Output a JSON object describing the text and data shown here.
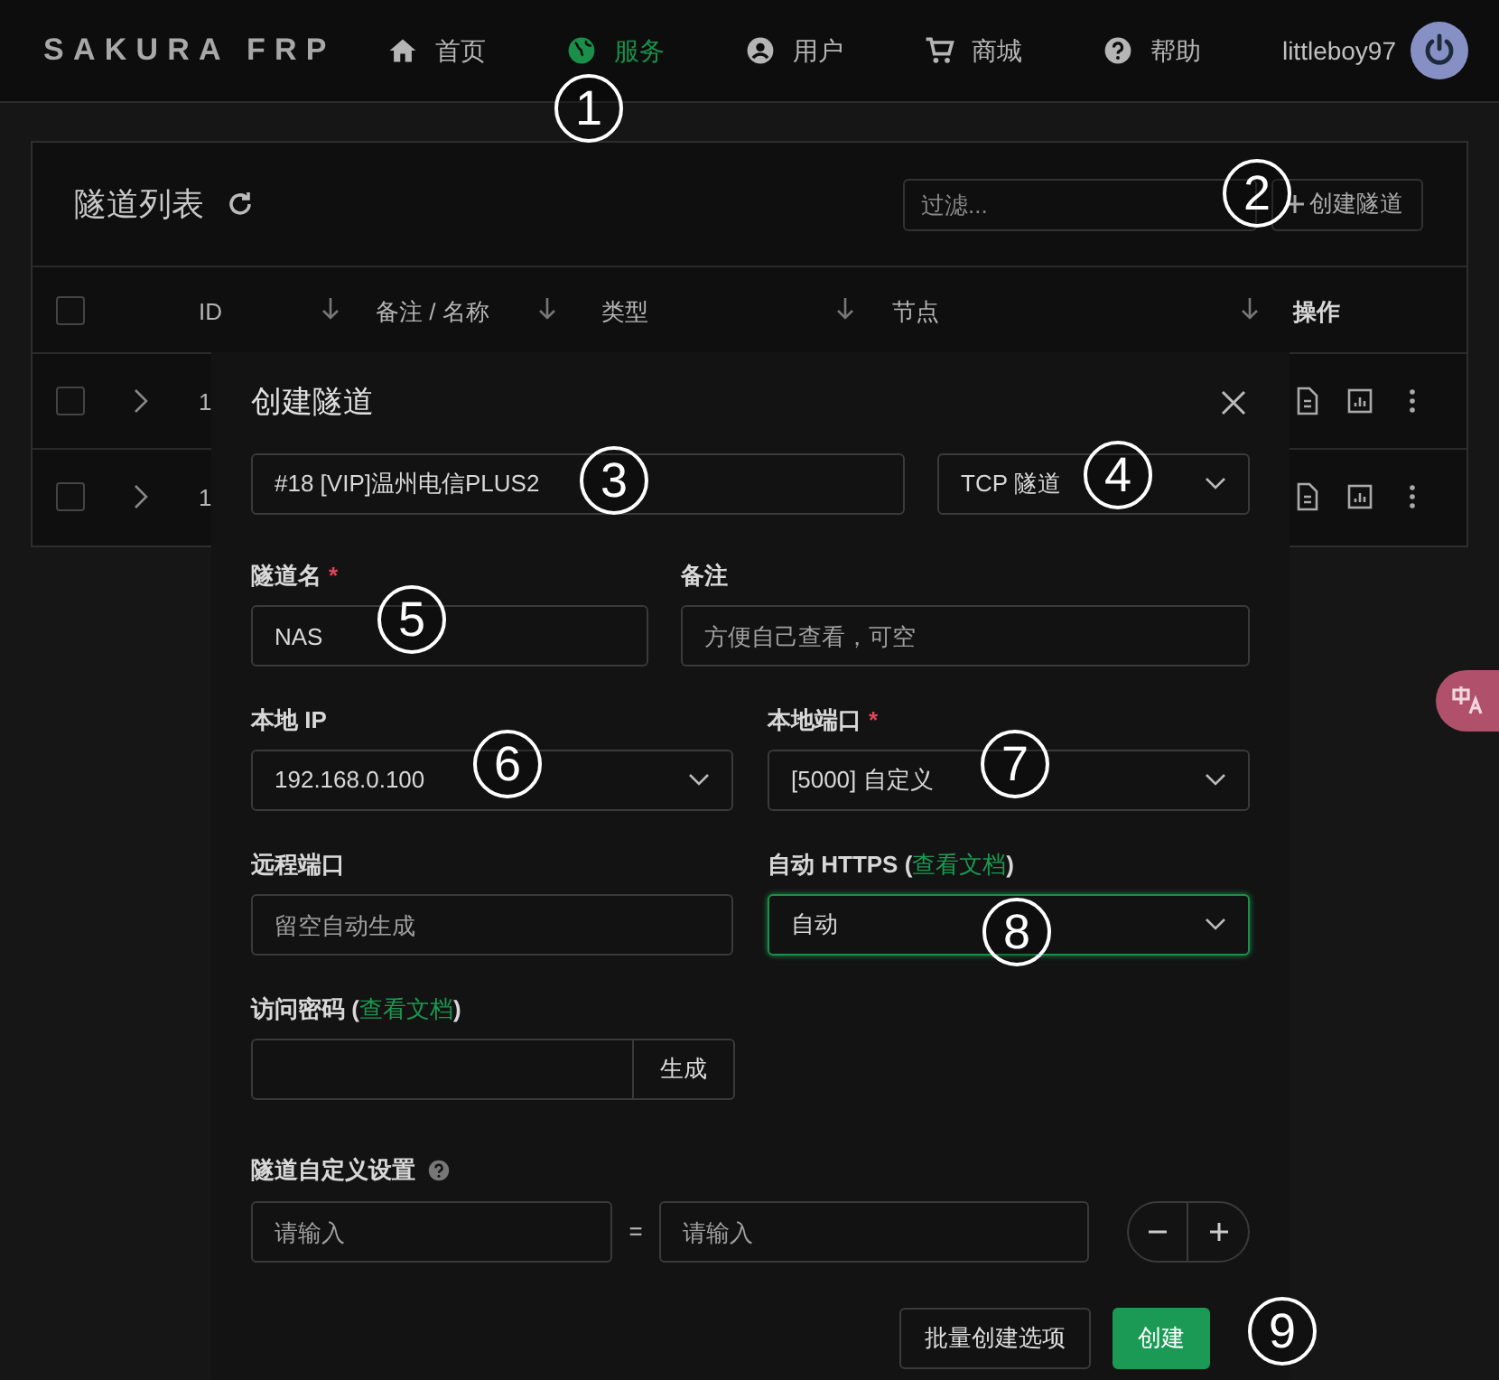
{
  "nav": {
    "logo": "SAKURA FRP",
    "items": [
      {
        "label": "首页",
        "selected": false
      },
      {
        "label": "服务",
        "selected": true
      },
      {
        "label": "用户",
        "selected": false
      },
      {
        "label": "商城",
        "selected": false
      },
      {
        "label": "帮助",
        "selected": false
      }
    ],
    "username": "littleboy97"
  },
  "tunnel_list": {
    "title": "隧道列表",
    "filter": {
      "placeholder": "过滤..."
    },
    "create_button": "创建隧道",
    "header_checked": false,
    "columns": [
      {
        "label": "ID",
        "sortable": true
      },
      {
        "label": "备注 / 名称",
        "sortable": true
      },
      {
        "label": "类型",
        "sortable": true
      },
      {
        "label": "节点",
        "sortable": true
      },
      {
        "label": "操作",
        "sortable": false
      }
    ],
    "rows": [
      {
        "id": "1",
        "checked": false
      },
      {
        "id": "1",
        "checked": false
      }
    ]
  },
  "dialog": {
    "title": "创建隧道",
    "rows": [
      [
        {
          "kind": "input",
          "value": "#18 [VIP]温州电信PLUS2"
        },
        {
          "kind": "select",
          "value": "TCP 隧道"
        }
      ],
      [
        {
          "kind": "input",
          "label": "隧道名",
          "required_mark": "*",
          "value": "NAS"
        },
        {
          "kind": "input",
          "label": "备注",
          "placeholder": "方便自己查看，可空"
        }
      ],
      [
        {
          "kind": "select",
          "label": "本地 IP",
          "value": "192.168.0.100"
        },
        {
          "kind": "select",
          "label": "本地端口",
          "required_mark": "*",
          "value": "[5000] 自定义"
        }
      ],
      [
        {
          "kind": "input",
          "label": "远程端口",
          "placeholder": "留空自动生成"
        },
        {
          "kind": "select",
          "label": "自动 HTTPS (",
          "link": "查看文档",
          "label_end": ")",
          "value": "自动",
          "focused": true
        }
      ]
    ],
    "password": {
      "label": "访问密码 (",
      "link": "查看文档",
      "label_end": ")",
      "button": "生成"
    },
    "custom": {
      "label": "隧道自定义设置",
      "key_placeholder": "请输入",
      "equals": "=",
      "value_placeholder": "请输入"
    },
    "buttons": [
      {
        "label": "批量创建选项",
        "kind": "secondary"
      },
      {
        "label": "创建",
        "kind": "primary"
      }
    ]
  },
  "annotations": [
    {
      "label": "1"
    },
    {
      "label": "2"
    },
    {
      "label": "3"
    },
    {
      "label": "4"
    },
    {
      "label": "5"
    },
    {
      "label": "6"
    },
    {
      "label": "7"
    },
    {
      "label": "8"
    },
    {
      "label": "9"
    }
  ]
}
